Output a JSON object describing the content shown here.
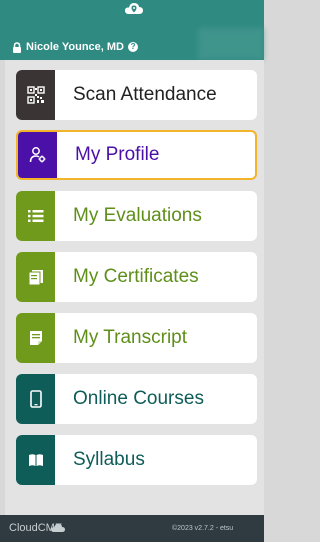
{
  "header": {
    "user_name": "Nicole Younce, MD",
    "logo_icon": "location-pin-cloud-icon",
    "lock_icon": "lock-icon",
    "help_icon": "help-icon",
    "help_glyph": "?"
  },
  "menu": {
    "items": [
      {
        "label": "Scan Attendance",
        "icon": "qr-code-icon",
        "color": "#3b3434",
        "label_color": "#222222"
      },
      {
        "label": "My Profile",
        "icon": "user-gear-icon",
        "color": "#4b10a8",
        "label_color": "#4b10a8",
        "selected": true
      },
      {
        "label": "My Evaluations",
        "icon": "list-icon",
        "color": "#6f9a1b",
        "label_color": "#5f8f1a"
      },
      {
        "label": "My Certificates",
        "icon": "certificate-icon",
        "color": "#6f9a1b",
        "label_color": "#5f8f1a"
      },
      {
        "label": "My Transcript",
        "icon": "transcript-icon",
        "color": "#6f9a1b",
        "label_color": "#5f8f1a"
      },
      {
        "label": "Online Courses",
        "icon": "mobile-icon",
        "color": "#0f5d58",
        "label_color": "#0f5d58"
      },
      {
        "label": "Syllabus",
        "icon": "book-icon",
        "color": "#0f5d58",
        "label_color": "#0f5d58"
      }
    ]
  },
  "footer": {
    "brand": "CloudCME",
    "version": "©2023 v2.7.2 - etsu"
  },
  "colors": {
    "header_bg": "#2f8a82",
    "footer_bg": "#2f3b41",
    "selected_border": "#f2b52a"
  }
}
